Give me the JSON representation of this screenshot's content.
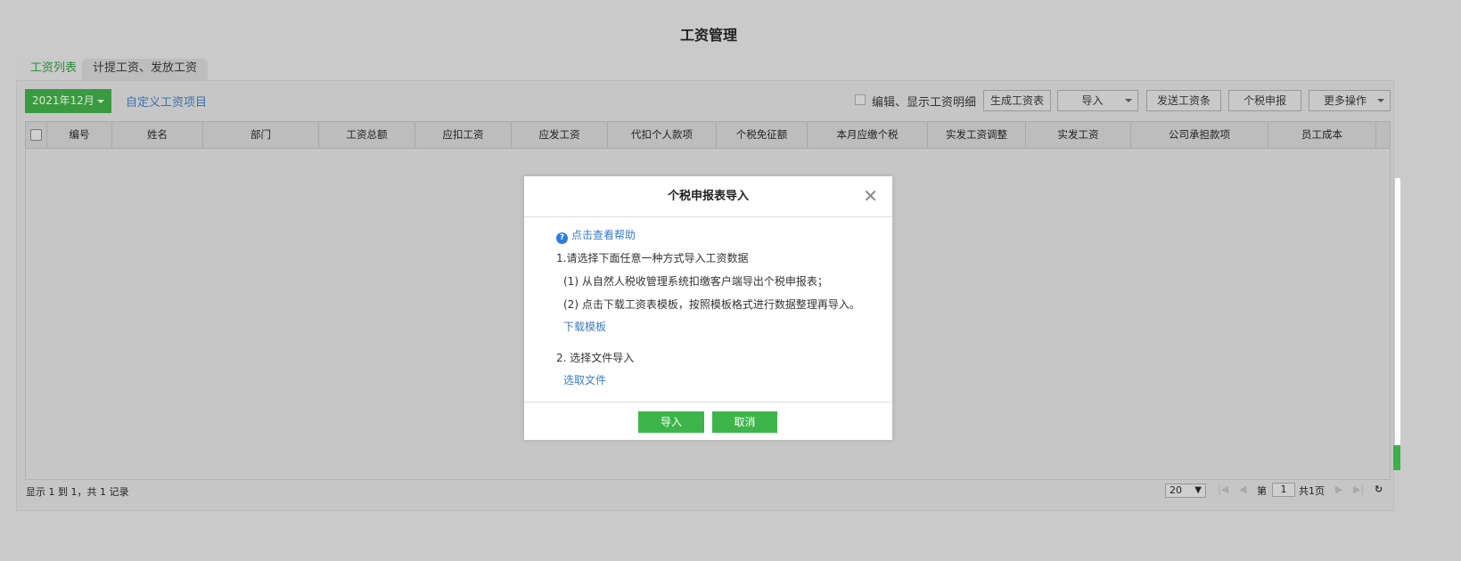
{
  "page": {
    "title": "工资管理"
  },
  "tabs": [
    {
      "label": "工资列表"
    },
    {
      "label": "计提工资、发放工资"
    }
  ],
  "toolbar": {
    "period": "2021年12月",
    "custom_items": "自定义工资项目",
    "show_detail": "编辑、显示工资明细",
    "generate": "生成工资表",
    "import": "导入",
    "send": "发送工资条",
    "tax_report": "个税申报",
    "more": "更多操作"
  },
  "table": {
    "columns": [
      "编号",
      "姓名",
      "部门",
      "工资总额",
      "应扣工资",
      "应发工资",
      "代扣个人款项",
      "个税免征额",
      "本月应缴个税",
      "实发工资调整",
      "实发工资",
      "公司承担款项",
      "员工成本"
    ]
  },
  "footer": {
    "info": "显示 1 到 1，共 1 记录",
    "page_size": "20",
    "page_prefix": "第",
    "page": "1",
    "page_total": "共1页"
  },
  "modal": {
    "title": "个税申报表导入",
    "help": "点击查看帮助",
    "step1": "1.请选择下面任意一种方式导入工资数据",
    "opt1": "(1) 从自然人税收管理系统扣缴客户端导出个税申报表；",
    "opt2": "(2) 点击下载工资表模板，按照模板格式进行数据整理再导入。",
    "download": "下载模板",
    "step2": "2. 选择文件导入",
    "choose": "选取文件",
    "ok": "导入",
    "cancel": "取消"
  },
  "colors": {
    "green": "#3db54a",
    "link": "#3a7cc8"
  }
}
